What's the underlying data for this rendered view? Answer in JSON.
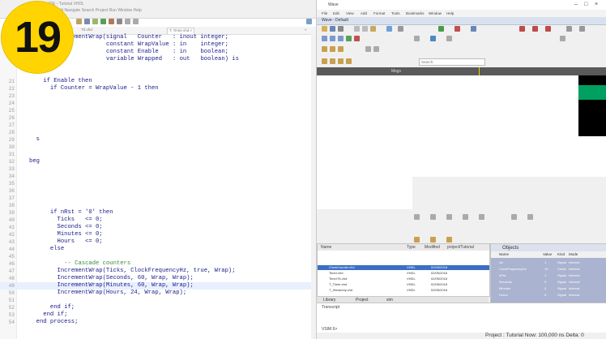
{
  "badge": {
    "number": "19"
  },
  "editor": {
    "code_lines": [
      {
        "n": "",
        "indent": 8,
        "text": "IncrementWrap(signal   Counter   : inout integer;"
      },
      {
        "n": "",
        "indent": 22,
        "text": "constant WrapValue : in    integer;"
      },
      {
        "n": "",
        "indent": 22,
        "text": "constant Enable    : in    boolean;"
      },
      {
        "n": "",
        "indent": 22,
        "text": "variable Wrapped   : out   boolean) is"
      },
      {
        "n": "",
        "indent": 0,
        "text": ""
      },
      {
        "n": "",
        "indent": 0,
        "text": ""
      },
      {
        "n": "21",
        "indent": 4,
        "text": "if Enable then"
      },
      {
        "n": "22",
        "indent": 6,
        "text": "if Counter = WrapValue - 1 then"
      },
      {
        "n": "23",
        "indent": 0,
        "text": ""
      },
      {
        "n": "24",
        "indent": 0,
        "text": ""
      },
      {
        "n": "25",
        "indent": 0,
        "text": ""
      },
      {
        "n": "26",
        "indent": 0,
        "text": ""
      },
      {
        "n": "27",
        "indent": 0,
        "text": ""
      },
      {
        "n": "28",
        "indent": 0,
        "text": ""
      },
      {
        "n": "29",
        "indent": 2,
        "text": "s"
      },
      {
        "n": "30",
        "indent": 0,
        "text": ""
      },
      {
        "n": "31",
        "indent": 0,
        "text": ""
      },
      {
        "n": "32",
        "indent": 0,
        "text": "beg"
      },
      {
        "n": "33",
        "indent": 0,
        "text": ""
      },
      {
        "n": "34",
        "indent": 0,
        "text": ""
      },
      {
        "n": "35",
        "indent": 0,
        "text": ""
      },
      {
        "n": "36",
        "indent": 0,
        "text": ""
      },
      {
        "n": "37",
        "indent": 0,
        "text": ""
      },
      {
        "n": "38",
        "indent": 0,
        "text": ""
      },
      {
        "n": "39",
        "indent": 6,
        "text": "if nRst = '0' then"
      },
      {
        "n": "40",
        "indent": 8,
        "text": "Ticks   <= 0;"
      },
      {
        "n": "41",
        "indent": 8,
        "text": "Seconds <= 0;"
      },
      {
        "n": "42",
        "indent": 8,
        "text": "Minutes <= 0;"
      },
      {
        "n": "43",
        "indent": 8,
        "text": "Hours   <= 0;"
      },
      {
        "n": "44",
        "indent": 6,
        "text": "else"
      },
      {
        "n": "45",
        "indent": 0,
        "text": ""
      },
      {
        "n": "46",
        "indent": 10,
        "text": "-- Cascade counters"
      },
      {
        "n": "47",
        "indent": 8,
        "text": "IncrementWrap(Ticks, ClockFrequencyHz, true, Wrap);"
      },
      {
        "n": "48",
        "indent": 8,
        "text": "IncrementWrap(Seconds, 60, Wrap, Wrap);"
      },
      {
        "n": "49",
        "indent": 8,
        "text": "IncrementWrap(Minutes, 60, Wrap, Wrap);"
      },
      {
        "n": "50",
        "indent": 8,
        "text": "IncrementWrap(Hours, 24, Wrap, Wrap);"
      },
      {
        "n": "51",
        "indent": 0,
        "text": ""
      },
      {
        "n": "52",
        "indent": 6,
        "text": "end if;"
      },
      {
        "n": "53",
        "indent": 4,
        "text": "end if;"
      },
      {
        "n": "54",
        "indent": 2,
        "text": "end process;"
      }
    ],
    "highlight_line": 34,
    "comment_line": 31
  },
  "sim": {
    "title": "Wave",
    "wave_title": "Wave - Default",
    "search_placeholder": "Search:",
    "wave_header": "Msgs",
    "selected_signal": "/clk",
    "library_tabs": [
      "Library",
      "Project",
      "sim"
    ],
    "library_header": [
      "Name",
      "Type",
      "Modified"
    ],
    "library_path": "project/Tutorial",
    "objects_title": "Objects",
    "objects_header": [
      "Name",
      "Value",
      "Kind",
      "Mode"
    ],
    "objects_rows": [
      {
        "name": "clk",
        "value": "1",
        "kind": "Signal",
        "mode": "Internal"
      },
      {
        "name": "ClockFrequencyHz",
        "value": "10",
        "kind": "Const",
        "mode": "Internal"
      },
      {
        "name": "nRst",
        "value": "1",
        "kind": "Signal",
        "mode": "Internal"
      },
      {
        "name": "Seconds",
        "value": "0",
        "kind": "Signal",
        "mode": "Internal"
      },
      {
        "name": "Minutes",
        "value": "0",
        "kind": "Signal",
        "mode": "Internal"
      },
      {
        "name": "Hours",
        "value": "0",
        "kind": "Signal",
        "mode": "Internal"
      }
    ],
    "transcript_label": "Transcript",
    "vsim_prompt": "VSIM 6>",
    "status": "Project : Tutorial   Now: 100,000 ns   Delta: 0"
  },
  "colors": {
    "badge": "#ffd400",
    "keyword": "#1a1a8a",
    "comment": "#3a8a3a",
    "line_highlight": "#e8f0fe",
    "cursor": "#f2d200",
    "objects_bg": "#aab3cf"
  }
}
